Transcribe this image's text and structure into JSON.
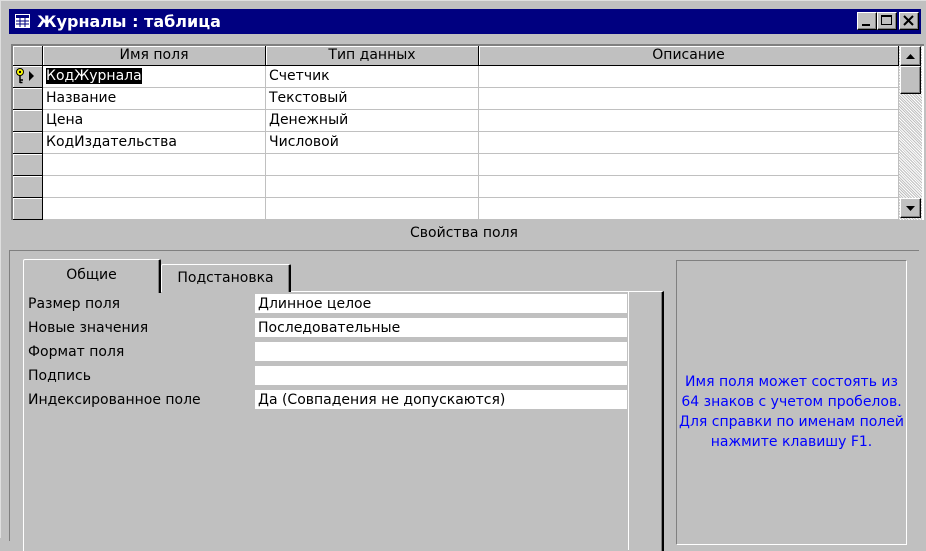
{
  "window": {
    "title": "Журналы : таблица",
    "title_icon": "table-icon",
    "buttons": [
      "minimize-icon",
      "maximize-icon",
      "close-icon"
    ]
  },
  "grid": {
    "headers": [
      "Имя поля",
      "Тип данных",
      "Описание"
    ],
    "rows": [
      {
        "name": "КодЖурнала",
        "type": "Счетчик",
        "description": "",
        "primary_key": true,
        "current": true
      },
      {
        "name": "Название",
        "type": "Текстовый",
        "description": ""
      },
      {
        "name": "Цена",
        "type": "Денежный",
        "description": ""
      },
      {
        "name": "КодИздательства",
        "type": "Числовой",
        "description": ""
      },
      {
        "name": "",
        "type": "",
        "description": ""
      },
      {
        "name": "",
        "type": "",
        "description": ""
      },
      {
        "name": "",
        "type": "",
        "description": ""
      }
    ]
  },
  "properties": {
    "title": "Свойства поля",
    "tabs": [
      "Общие",
      "Подстановка"
    ],
    "active_tab": "Общие",
    "items": [
      {
        "label": "Размер поля",
        "value": "Длинное целое"
      },
      {
        "label": "Новые значения",
        "value": "Последовательные"
      },
      {
        "label": "Формат поля",
        "value": ""
      },
      {
        "label": "Подпись",
        "value": ""
      },
      {
        "label": "Индексированное поле",
        "value": "Да (Совпадения не допускаются)"
      }
    ],
    "help_text": "Имя поля может состоять из 64 знаков с учетом пробелов. Для справки по именам полей нажмите клавишу F1."
  },
  "colors": {
    "titlebar": "#000080",
    "face": "#c0c0c0",
    "help_text": "#0000ff"
  }
}
